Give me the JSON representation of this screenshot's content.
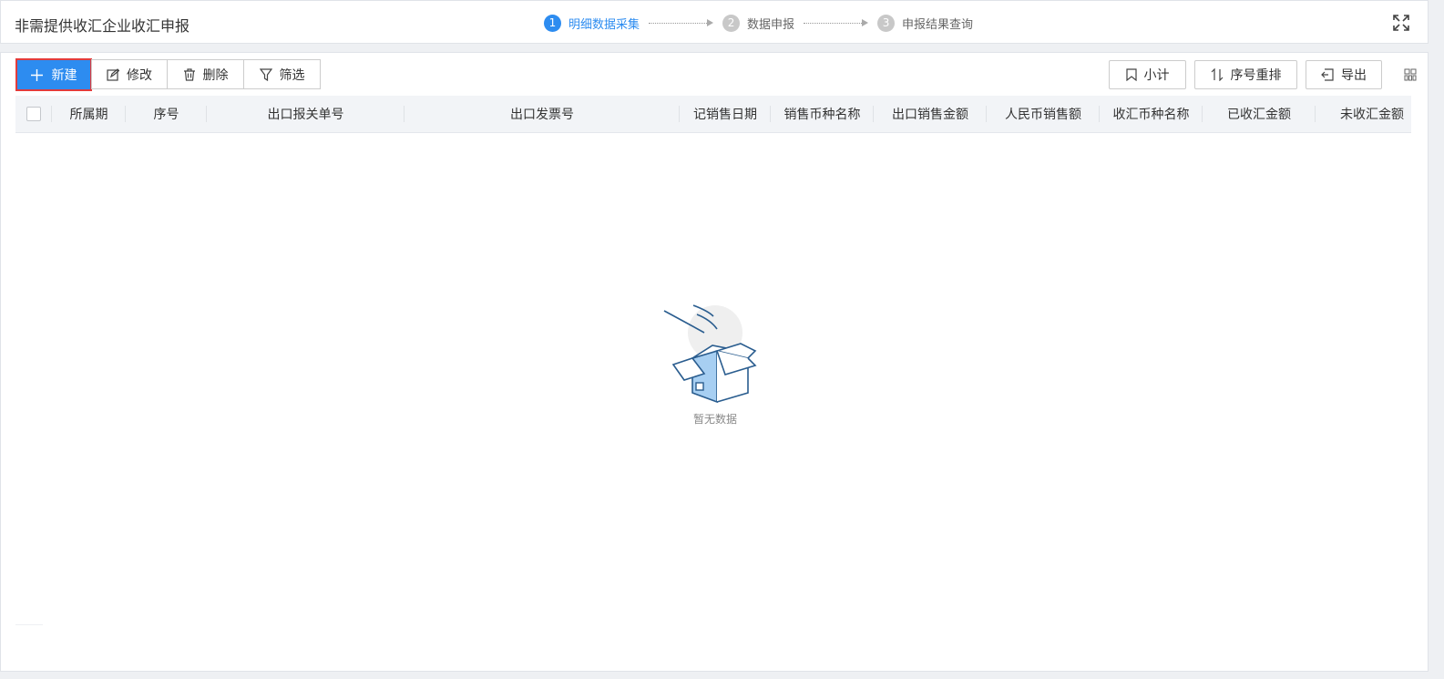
{
  "header": {
    "title": "非需提供收汇企业收汇申报",
    "steps": [
      {
        "num": "1",
        "label": "明细数据采集",
        "active": true
      },
      {
        "num": "2",
        "label": "数据申报",
        "active": false
      },
      {
        "num": "3",
        "label": "申报结果查询",
        "active": false
      }
    ],
    "fullscreen_icon": "expand-icon"
  },
  "toolbar": {
    "new_label": "新建",
    "edit_label": "修改",
    "delete_label": "删除",
    "filter_label": "筛选",
    "subtotal_label": "小计",
    "reorder_label": "序号重排",
    "export_label": "导出"
  },
  "table": {
    "columns": [
      "所属期",
      "序号",
      "出口报关单号",
      "出口发票号",
      "记销售日期",
      "销售币种名称",
      "出口销售金额",
      "人民币销售额",
      "收汇币种名称",
      "已收汇金额",
      "未收汇金额"
    ]
  },
  "empty": {
    "text": "暂无数据"
  },
  "colors": {
    "primary": "#2d8cf0",
    "highlight_border": "#e23b3b"
  }
}
